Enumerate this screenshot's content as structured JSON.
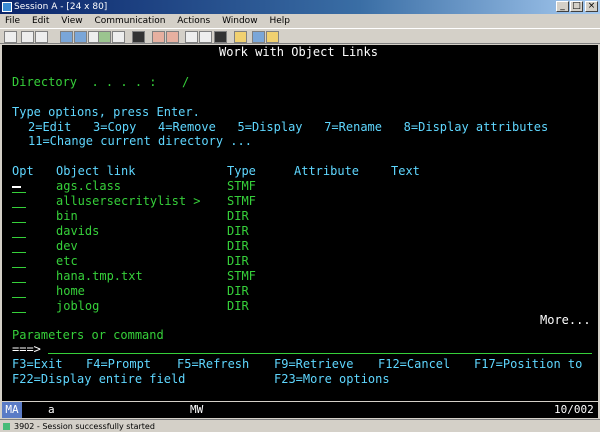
{
  "window": {
    "title": "Session A - [24 x 80]",
    "min_label": "_",
    "max_label": "□",
    "close_label": "×"
  },
  "menu": [
    "File",
    "Edit",
    "View",
    "Communication",
    "Actions",
    "Window",
    "Help"
  ],
  "screen": {
    "title": "Work with Object Links",
    "directory_label": "Directory  . . . . :",
    "directory_value": "/",
    "instructions": "Type options, press Enter.",
    "options_line1": "2=Edit   3=Copy   4=Remove   5=Display   7=Rename   8=Display attributes",
    "options_line2": "11=Change current directory ...",
    "headers": {
      "opt": "Opt",
      "object": "Object link",
      "type": "Type",
      "attribute": "Attribute",
      "text": "Text"
    },
    "rows": [
      {
        "name": "ags.class",
        "type": "STMF"
      },
      {
        "name": "allusersecritylist >",
        "type": "STMF"
      },
      {
        "name": "bin",
        "type": "DIR"
      },
      {
        "name": "davids",
        "type": "DIR"
      },
      {
        "name": "dev",
        "type": "DIR"
      },
      {
        "name": "etc",
        "type": "DIR"
      },
      {
        "name": "hana.tmp.txt",
        "type": "STMF"
      },
      {
        "name": "home",
        "type": "DIR"
      },
      {
        "name": "joblog",
        "type": "DIR"
      }
    ],
    "more": "More...",
    "params_label": "Parameters or command",
    "prompt": "===>",
    "fkeys_line1": [
      "F3=Exit",
      "F4=Prompt",
      "F5=Refresh",
      "F9=Retrieve",
      "F12=Cancel",
      "F17=Position to"
    ],
    "fkeys_line2": [
      "F22=Display entire field",
      "F23=More options"
    ]
  },
  "oia": {
    "ma": "MA",
    "a": "a",
    "mw": "MW",
    "pos": "10/002"
  },
  "status": "3902 - Session successfully started"
}
